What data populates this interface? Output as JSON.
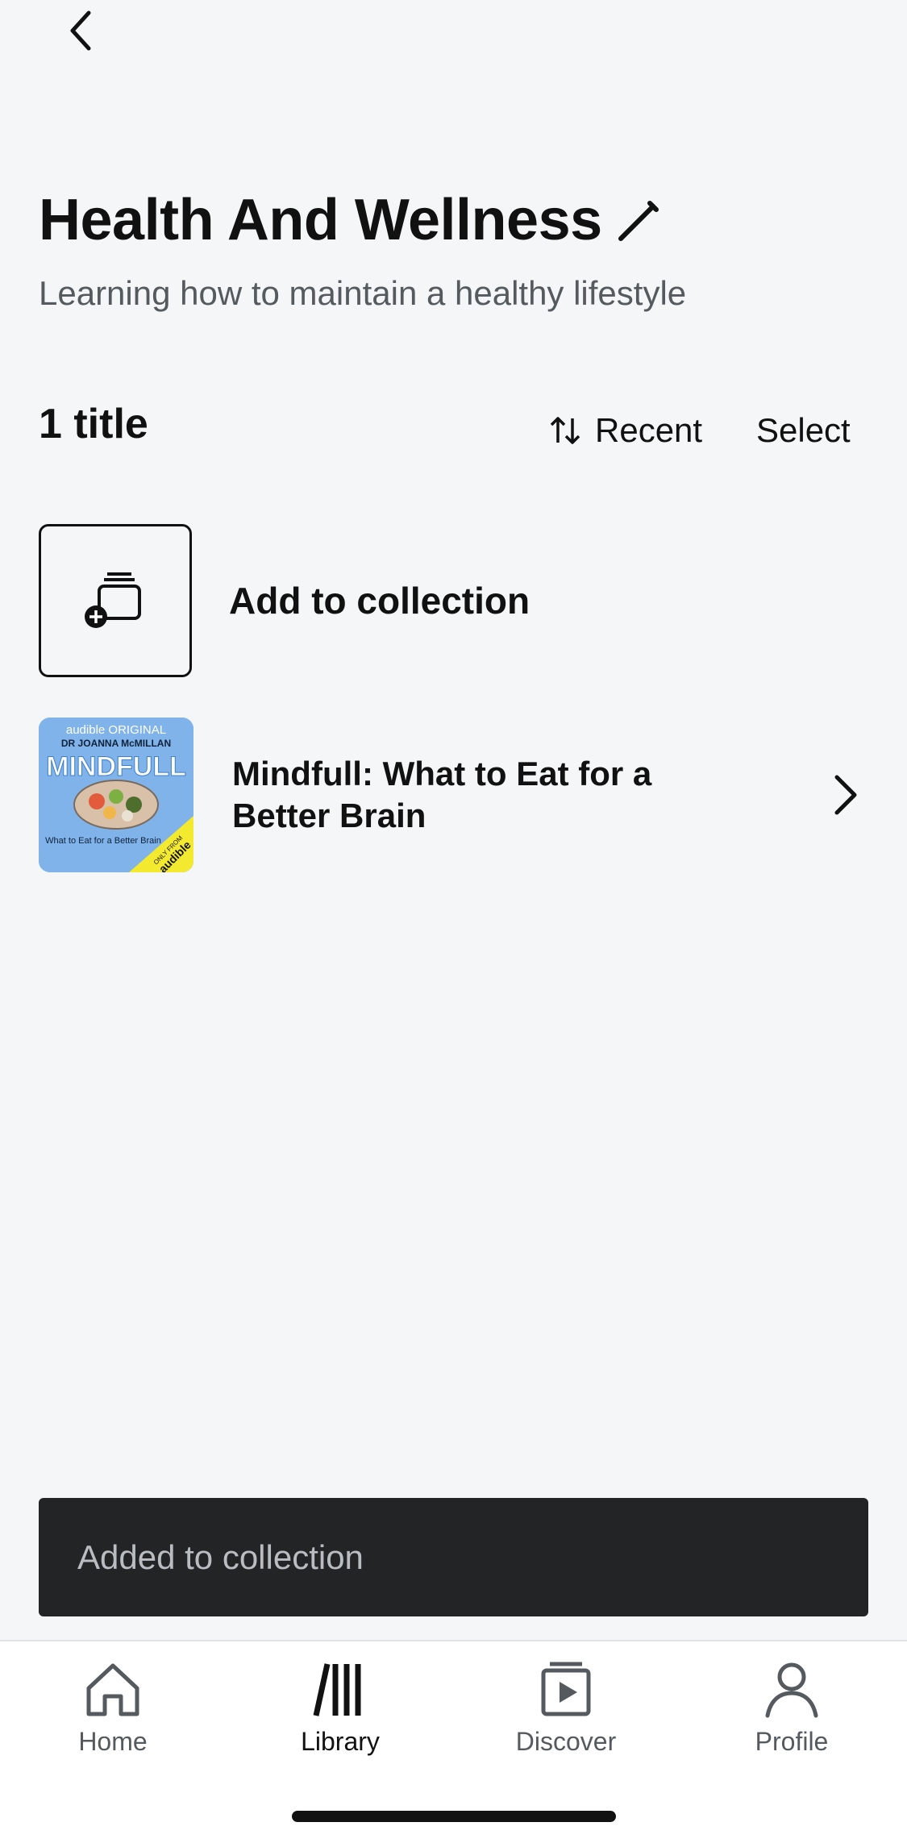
{
  "header": {
    "back_icon": "chevron-left-icon",
    "title": "Health And Wellness",
    "edit_icon": "pencil-icon",
    "subtitle": "Learning how to maintain a healthy lifestyle"
  },
  "toolbar": {
    "count": "1 title",
    "sort_icon": "sort-arrows-icon",
    "sort_label": "Recent",
    "select_label": "Select"
  },
  "list": {
    "add_label": "Add to collection",
    "items": [
      {
        "title": "Mindfull: What to Eat for a Better Brain",
        "cover": {
          "top_line": "audible ORIGINAL",
          "author": "DR JOANNA McMILLAN",
          "name": "MINDFULL",
          "tagline": "What to Eat for a Better Brain",
          "badge_small": "ONLY FROM",
          "badge_brand": "audible"
        }
      }
    ]
  },
  "toast": {
    "message": "Added to collection"
  },
  "tabbar": {
    "tabs": [
      {
        "label": "Home",
        "icon": "home-icon"
      },
      {
        "label": "Library",
        "icon": "library-icon"
      },
      {
        "label": "Discover",
        "icon": "discover-icon"
      },
      {
        "label": "Profile",
        "icon": "profile-icon"
      }
    ],
    "active": "Library"
  },
  "colors": {
    "background": "#f4f6f7",
    "toast_background": "#232425",
    "cover_blue": "#7fb3ea",
    "badge_yellow": "#f3ea2f"
  }
}
